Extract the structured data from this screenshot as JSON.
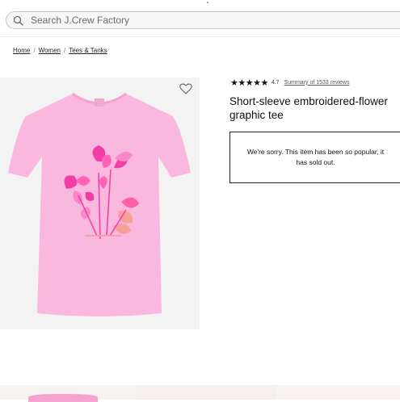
{
  "search": {
    "placeholder": "Search J.Crew Factory"
  },
  "breadcrumb": [
    {
      "label": "Home"
    },
    {
      "label": "Women"
    },
    {
      "label": "Tees & Tanks"
    }
  ],
  "breadcrumb_separator": "/",
  "product": {
    "rating_value": "4.7",
    "rating_stars": "★★★★★",
    "reviews_link": "Summary of 1533 reviews",
    "title": "Short-sleeve embroidered-flower graphic tee",
    "soldout_message": "We're sorry. This item has been so popular, it has sold out."
  },
  "colors": {
    "shirt": "#fbb8df",
    "flower_primary": "#f23da6",
    "flower_light": "#fb86c8",
    "flower_coral": "#f5a19a",
    "gallery_bg": "#f3f3f3"
  },
  "icons": {
    "search": "search-icon",
    "wishlist": "heart-icon"
  }
}
